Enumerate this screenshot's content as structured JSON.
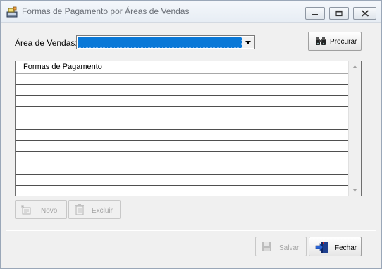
{
  "window": {
    "title": "Formas de Pagamento por Áreas de Vendas",
    "icon": "cash-register-icon"
  },
  "filter": {
    "area_label": "Área de Vendas:",
    "area_value": "",
    "search_button": "Procurar"
  },
  "grid": {
    "column_header": "Formas de Pagamento",
    "rows": [
      "",
      "",
      "",
      "",
      "",
      "",
      "",
      "",
      "",
      ""
    ]
  },
  "actions": {
    "new_label": "Novo",
    "delete_label": "Excluir"
  },
  "footer": {
    "save_label": "Salvar",
    "close_label": "Fechar"
  },
  "colors": {
    "selection": "#0a78d7",
    "title_text": "#6a6f77"
  }
}
